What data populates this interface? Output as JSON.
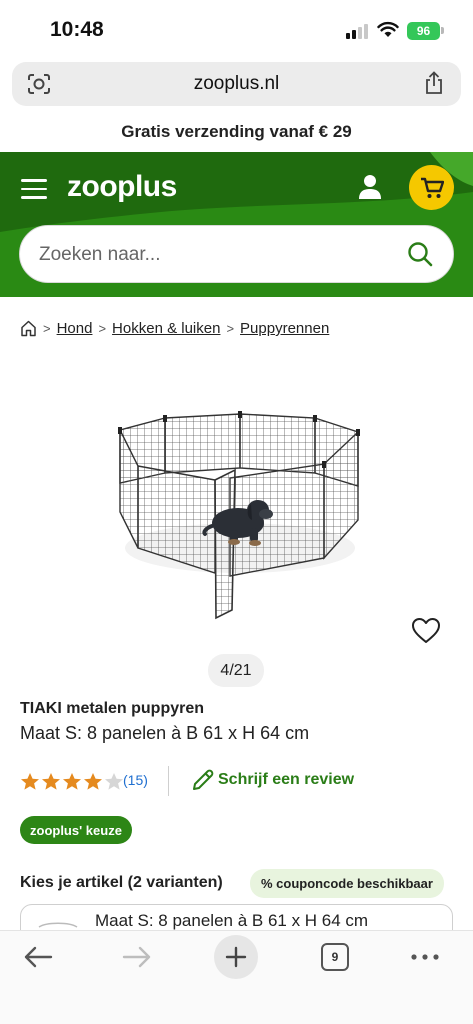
{
  "status_bar": {
    "time": "10:48",
    "battery": "96"
  },
  "browser": {
    "url": "zooplus.nl",
    "tab_count": "9"
  },
  "promo": {
    "text": "Gratis verzending vanaf € 29"
  },
  "header": {
    "logo": "zooplus",
    "search_placeholder": "Zoeken naar..."
  },
  "breadcrumb": {
    "items": [
      "Hond",
      "Hokken & luiken",
      "Puppyrennen"
    ]
  },
  "product": {
    "image_counter": "4/21",
    "brand": "TIAKI metalen puppyren",
    "subtitle": "Maat S: 8 panelen à B 61 x H 64 cm",
    "rating": 4,
    "rating_max": 5,
    "review_count": "(15)",
    "write_review": "Schrijf een review",
    "badge": "zooplus' keuze"
  },
  "variants": {
    "title": "Kies je artikel (2 varianten)",
    "coupon": "% couponcode beschikbaar",
    "items": [
      {
        "label": "Maat S: 8 panelen à B 61 x H 64 cm"
      }
    ]
  },
  "colors": {
    "brand_green": "#2a8a14",
    "cart_yellow": "#f5c800",
    "star": "#e58a1f",
    "link_blue": "#1f6fd0"
  }
}
